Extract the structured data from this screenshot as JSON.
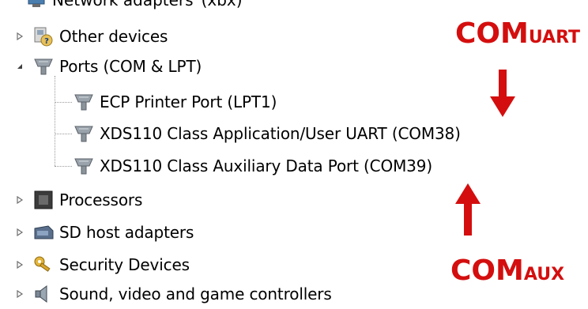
{
  "window": {
    "title": ""
  },
  "device_tree": {
    "partial_top_item": {
      "label": "Network adapters",
      "suffix": "(xbx)"
    },
    "items": [
      {
        "label": "Other devices",
        "icon": "other-devices-icon",
        "expanded": false
      },
      {
        "label": "Ports (COM & LPT)",
        "icon": "port-icon",
        "expanded": true
      },
      {
        "label": "ECP Printer Port (LPT1)",
        "icon": "port-icon",
        "child": true
      },
      {
        "label": "XDS110 Class Application/User UART (COM38)",
        "icon": "port-icon",
        "child": true
      },
      {
        "label": "XDS110 Class Auxiliary Data Port (COM39)",
        "icon": "port-icon",
        "child": true
      },
      {
        "label": "Processors",
        "icon": "processor-icon",
        "expanded": false
      },
      {
        "label": "SD host adapters",
        "icon": "sd-host-icon",
        "expanded": false
      },
      {
        "label": "Security Devices",
        "icon": "security-key-icon",
        "expanded": false
      },
      {
        "label": "Sound, video and game controllers",
        "icon": "speaker-icon",
        "expanded": false
      }
    ]
  },
  "annotations": {
    "uart": {
      "main": "COM",
      "sub": "UART"
    },
    "aux": {
      "main": "COM",
      "sub": "AUX"
    },
    "color": "#d40e0e"
  }
}
